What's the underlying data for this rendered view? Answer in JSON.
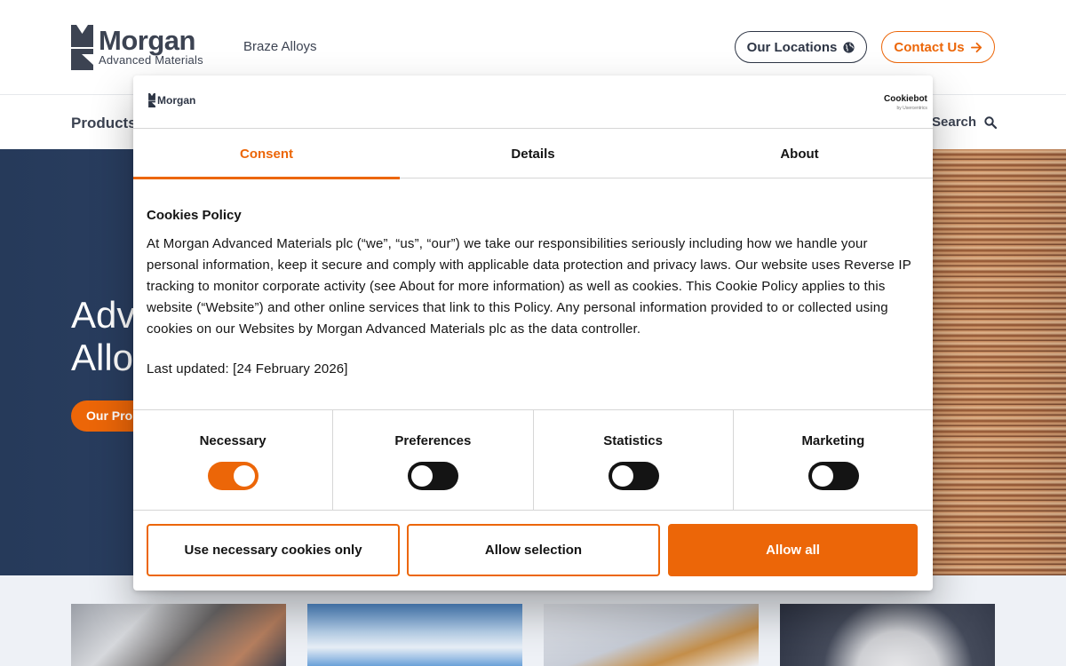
{
  "header": {
    "logo_name": "Morgan",
    "logo_sub": "Advanced Materials",
    "site_name": "Braze Alloys",
    "locations_label": "Our Locations",
    "contact_label": "Contact Us"
  },
  "nav": {
    "products_label": "Products",
    "search_label": "Search"
  },
  "hero": {
    "title_line1": "Adv",
    "title_line2": "Alloy",
    "button_label": "Our Pro"
  },
  "cookie_dialog": {
    "logo_text": "Morgan",
    "provider": "Cookiebot",
    "provider_sub": "by Usercentrics",
    "tabs": [
      {
        "label": "Consent",
        "active": true
      },
      {
        "label": "Details",
        "active": false
      },
      {
        "label": "About",
        "active": false
      }
    ],
    "policy_title": "Cookies Policy",
    "policy_text": "At Morgan Advanced Materials plc (“we”, “us”, “our”) we take our responsibilities seriously including how we handle your personal information, keep it secure and comply with applicable data protection and privacy laws. Our website uses Reverse IP tracking to monitor corporate activity (see About for more information) as well as cookies. This Cookie Policy applies to this website (“Website”) and other online services that link to this Policy. Any personal information provided to or collected using cookies on our Websites by Morgan Advanced Materials plc as the data controller.",
    "last_updated": "Last updated: [24 February 2026]",
    "toggles": [
      {
        "label": "Necessary",
        "on": true
      },
      {
        "label": "Preferences",
        "on": false
      },
      {
        "label": "Statistics",
        "on": false
      },
      {
        "label": "Marketing",
        "on": false
      }
    ],
    "buttons": {
      "necessary_only": "Use necessary cookies only",
      "allow_selection": "Allow selection",
      "allow_all": "Allow all"
    }
  },
  "colors": {
    "accent": "#ec6608",
    "text_dark": "#141414",
    "navy": "#2d3545"
  }
}
